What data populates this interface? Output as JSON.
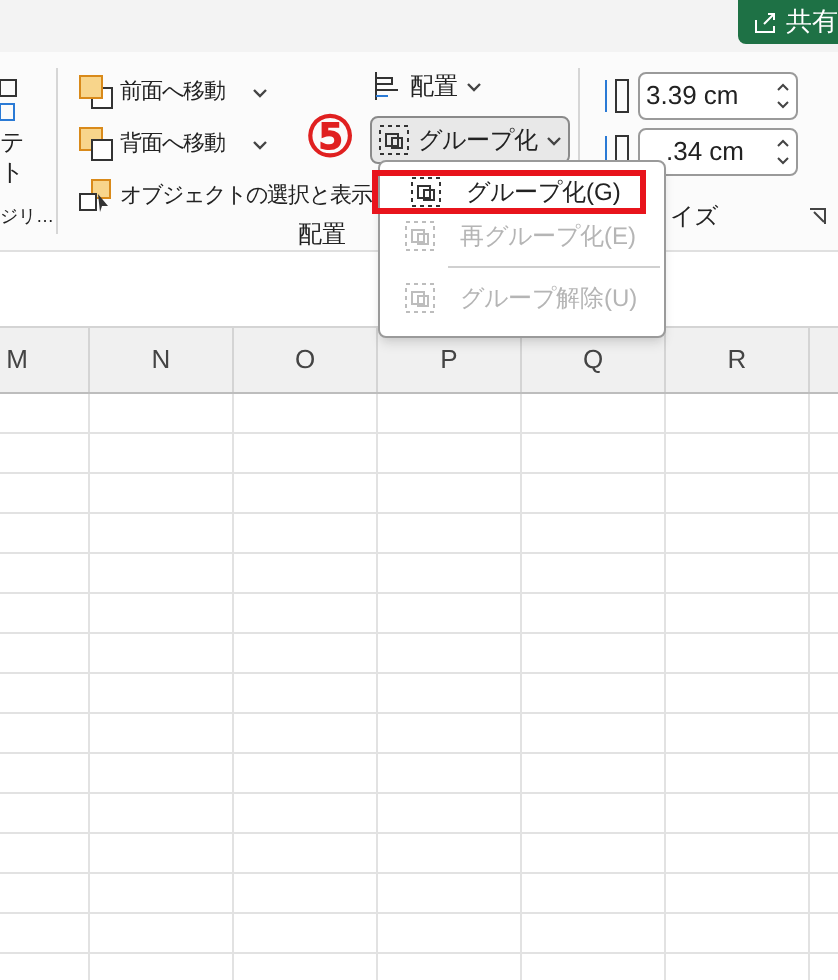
{
  "share_button": {
    "label": "共有"
  },
  "left_group": {
    "texts": [
      "テ",
      "ト"
    ],
    "label": "ジリ…"
  },
  "arrange_group": {
    "label": "配置",
    "commands": [
      {
        "label": "前面へ移動",
        "dropdown": true
      },
      {
        "label": "背面へ移動",
        "dropdown": true
      },
      {
        "label": "オブジェクトの選択と表示",
        "dropdown": false
      }
    ],
    "align_button": {
      "label": "配置"
    },
    "group_button": {
      "label": "グループ化",
      "pressed": true
    }
  },
  "size_group": {
    "label": "イズ",
    "fields": [
      {
        "value": "3.39 cm"
      },
      {
        "value": ".34 cm"
      }
    ]
  },
  "annotation": {
    "step": "⑤"
  },
  "menu": {
    "items": [
      {
        "kind": "item",
        "label": "グループ化(G)",
        "disabled": false,
        "highlighted": true
      },
      {
        "kind": "item",
        "label": "再グループ化(E)",
        "disabled": true,
        "highlighted": false
      },
      {
        "kind": "separator"
      },
      {
        "kind": "item",
        "label": "グループ解除(U)",
        "disabled": true,
        "highlighted": false
      }
    ]
  },
  "sheet": {
    "columns": [
      "M",
      "N",
      "O",
      "P",
      "Q",
      "R"
    ]
  }
}
